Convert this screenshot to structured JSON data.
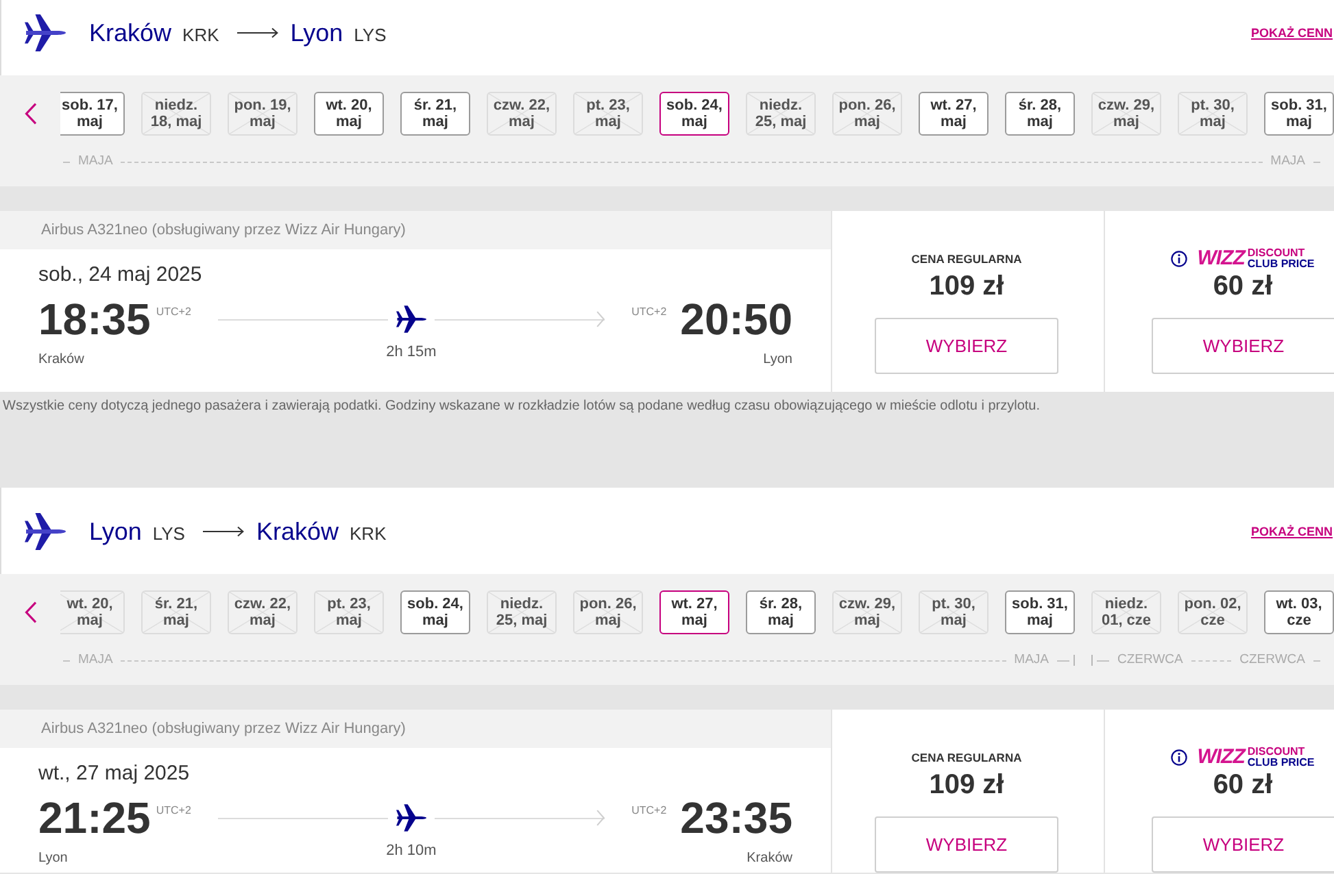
{
  "sections": [
    {
      "route": {
        "origin_city": "Kraków",
        "origin_code": "KRK",
        "destination_city": "Lyon",
        "destination_code": "LYS"
      },
      "show_prices_link": "POKAŻ CENN",
      "date_strip": {
        "months": [
          {
            "start_label": "MAJA",
            "end_label": "MAJA",
            "days": [
              {
                "label": "sob. 17, maj",
                "available": true,
                "selected": false
              },
              {
                "label": "niedz. 18, maj",
                "available": false,
                "selected": false
              },
              {
                "label": "pon. 19, maj",
                "available": false,
                "selected": false
              },
              {
                "label": "wt. 20, maj",
                "available": true,
                "selected": false
              },
              {
                "label": "śr. 21, maj",
                "available": true,
                "selected": false
              },
              {
                "label": "czw. 22, maj",
                "available": false,
                "selected": false
              },
              {
                "label": "pt. 23, maj",
                "available": false,
                "selected": false
              },
              {
                "label": "sob. 24, maj",
                "available": true,
                "selected": true
              },
              {
                "label": "niedz. 25, maj",
                "available": false,
                "selected": false
              },
              {
                "label": "pon. 26, maj",
                "available": false,
                "selected": false
              },
              {
                "label": "wt. 27, maj",
                "available": true,
                "selected": false
              },
              {
                "label": "śr. 28, maj",
                "available": true,
                "selected": false
              },
              {
                "label": "czw. 29, maj",
                "available": false,
                "selected": false
              },
              {
                "label": "pt. 30, maj",
                "available": false,
                "selected": false
              },
              {
                "label": "sob. 31, maj",
                "available": true,
                "selected": false
              }
            ]
          }
        ]
      },
      "flight": {
        "aircraft": "Airbus A321neo (obsługiwany przez Wizz Air Hungary)",
        "date": "sob., 24 maj 2025",
        "departure_time": "18:35",
        "departure_utc": "UTC+2",
        "arrival_utc": "UTC+2",
        "arrival_time": "20:50",
        "origin": "Kraków",
        "duration": "2h 15m",
        "destination": "Lyon"
      },
      "fares": [
        {
          "kind": "regular",
          "title": "CENA REGULARNA",
          "price": "109 zł",
          "button": "WYBIERZ"
        },
        {
          "kind": "club",
          "logo_text": "WIZZ",
          "label_lines": [
            "DISCOUNT",
            "CLUB PRICE"
          ],
          "price": "60 zł",
          "button": "WYBIERZ"
        }
      ],
      "note": "Wszystkie ceny dotyczą jednego pasażera i zawierają podatki. Godziny wskazane w rozkładzie lotów są podane według czasu obowiązującego w mieście odlotu i przylotu."
    },
    {
      "route": {
        "origin_city": "Lyon",
        "origin_code": "LYS",
        "destination_city": "Kraków",
        "destination_code": "KRK"
      },
      "show_prices_link": "POKAŻ CENN",
      "date_strip": {
        "months": [
          {
            "start_label": "MAJA",
            "end_label": "MAJA",
            "days": [
              {
                "label": "wt. 20, maj",
                "available": false,
                "selected": false
              },
              {
                "label": "śr. 21, maj",
                "available": false,
                "selected": false
              },
              {
                "label": "czw. 22, maj",
                "available": false,
                "selected": false
              },
              {
                "label": "pt. 23, maj",
                "available": false,
                "selected": false
              },
              {
                "label": "sob. 24, maj",
                "available": true,
                "selected": false
              },
              {
                "label": "niedz. 25, maj",
                "available": false,
                "selected": false
              },
              {
                "label": "pon. 26, maj",
                "available": false,
                "selected": false
              },
              {
                "label": "wt. 27, maj",
                "available": true,
                "selected": true
              },
              {
                "label": "śr. 28, maj",
                "available": true,
                "selected": false
              },
              {
                "label": "czw. 29, maj",
                "available": false,
                "selected": false
              },
              {
                "label": "pt. 30, maj",
                "available": false,
                "selected": false
              },
              {
                "label": "sob. 31, maj",
                "available": true,
                "selected": false
              }
            ]
          },
          {
            "start_label": "CZERWCA",
            "end_label": "CZERWCA",
            "days": [
              {
                "label": "niedz. 01, cze",
                "available": false,
                "selected": false
              },
              {
                "label": "pon. 02, cze",
                "available": false,
                "selected": false
              },
              {
                "label": "wt. 03, cze",
                "available": true,
                "selected": false
              }
            ]
          }
        ]
      },
      "flight": {
        "aircraft": "Airbus A321neo (obsługiwany przez Wizz Air Hungary)",
        "date": "wt., 27 maj 2025",
        "departure_time": "21:25",
        "departure_utc": "UTC+2",
        "arrival_utc": "UTC+2",
        "arrival_time": "23:35",
        "origin": "Lyon",
        "duration": "2h 10m",
        "destination": "Kraków"
      },
      "fares": [
        {
          "kind": "regular",
          "title": "CENA REGULARNA",
          "price": "109 zł",
          "button": "WYBIERZ"
        },
        {
          "kind": "club",
          "logo_text": "WIZZ",
          "label_lines": [
            "DISCOUNT",
            "CLUB PRICE"
          ],
          "price": "60 zł",
          "button": "WYBIERZ"
        }
      ]
    }
  ]
}
